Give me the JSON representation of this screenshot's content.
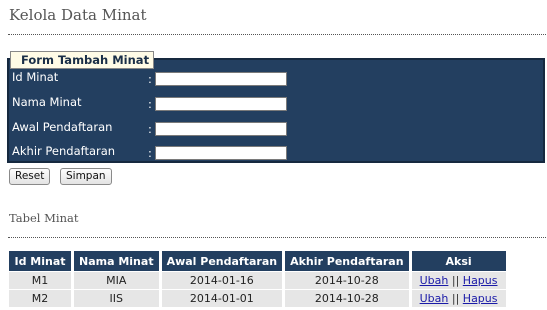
{
  "page": {
    "title": "Kelola Data Minat"
  },
  "form": {
    "legend": "Form Tambah Minat",
    "fields": [
      {
        "label": "Id Minat",
        "colon": ":",
        "value": "",
        "placeholder": ""
      },
      {
        "label": "Nama Minat",
        "colon": ":",
        "value": "",
        "placeholder": ""
      },
      {
        "label": "Awal Pendaftaran",
        "colon": ":",
        "value": "",
        "placeholder": ""
      },
      {
        "label": "Akhir Pendaftaran",
        "colon": ":",
        "value": "",
        "placeholder": ""
      }
    ],
    "buttons": {
      "reset": "Reset",
      "simpan": "Simpan"
    }
  },
  "table": {
    "title": "Tabel Minat",
    "headers": [
      "Id Minat",
      "Nama Minat",
      "Awal Pendaftaran",
      "Akhir Pendaftaran",
      "Aksi"
    ],
    "rows": [
      {
        "id": "M1",
        "nama": "MIA",
        "awal": "2014-01-16",
        "akhir": "2014-10-28",
        "ubah": "Ubah",
        "separator": "||",
        "hapus": "Hapus"
      },
      {
        "id": "M2",
        "nama": "IIS",
        "awal": "2014-01-01",
        "akhir": "2014-10-28",
        "ubah": "Ubah",
        "separator": "||",
        "hapus": "Hapus"
      }
    ]
  },
  "colors": {
    "panel": "#233f60",
    "legend_bg": "#fffbe6",
    "row_bg": "#e6e6e6",
    "link": "#1a1aa8"
  }
}
